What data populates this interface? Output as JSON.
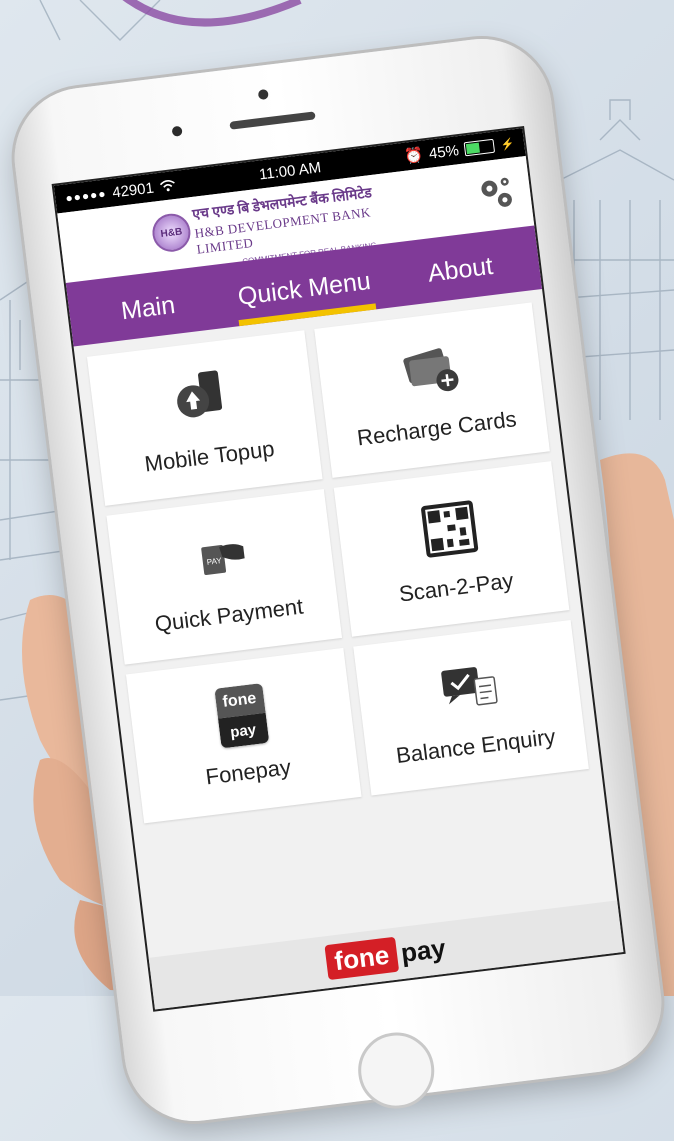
{
  "status": {
    "carrier": "42901",
    "time": "11:00 AM",
    "battery": "45%",
    "battery_level": 0.45
  },
  "bank": {
    "devanagari": "एच एण्ड बि डेभलपमेन्ट बैंक लिमिटेड",
    "name": "H&B DEVELOPMENT BANK LIMITED",
    "logo_text": "H&B",
    "tagline": "COMMITMENT FOR REAL BANKING"
  },
  "tabs": [
    {
      "label": "Main"
    },
    {
      "label": "Quick Menu"
    },
    {
      "label": "About"
    }
  ],
  "tiles": [
    {
      "label": "Mobile Topup",
      "icon": "mobile-topup-icon"
    },
    {
      "label": "Recharge Cards",
      "icon": "recharge-cards-icon"
    },
    {
      "label": "Quick Payment",
      "icon": "quick-payment-icon"
    },
    {
      "label": "Scan-2-Pay",
      "icon": "qr-code-icon"
    },
    {
      "label": "Fonepay",
      "icon": "fonepay-icon"
    },
    {
      "label": "Balance Enquiry",
      "icon": "balance-enquiry-icon"
    }
  ],
  "fonepay_icon": {
    "top": "fone",
    "bottom": "pay"
  },
  "footer": {
    "brand_red": "fone",
    "brand_black": "pay"
  },
  "colors": {
    "purple": "#803a98",
    "tab_underline": "#f3c200",
    "fonepay_red": "#d41f26"
  }
}
